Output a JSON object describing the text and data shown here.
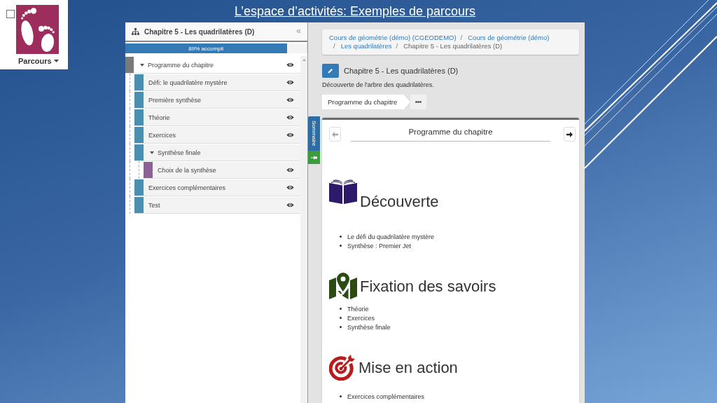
{
  "page": {
    "title": "L’espace d’activités: Exemples de parcours"
  },
  "menu": {
    "checked": false,
    "label": "Parcours"
  },
  "sidebar": {
    "title": "Chapitre 5 - Les quadrilatères (D)",
    "collapse": "«",
    "progress": {
      "level": 0.89,
      "label": "89% accompli"
    },
    "tree": [
      {
        "label": "Programme du chapitre",
        "selected": true,
        "expanded": true,
        "visible": true,
        "children": [
          {
            "label": "Défi: le quadrilatère mystère",
            "selected": false,
            "visible": true
          },
          {
            "label": "Première synthèse",
            "selected": false,
            "visible": true
          },
          {
            "label": "Théorie",
            "selected": false,
            "visible": true
          },
          {
            "label": "Exercices",
            "selected": false,
            "visible": true
          },
          {
            "label": "Synthèse finale",
            "selected": false,
            "expanded": true,
            "visible": false,
            "children": [
              {
                "label": "Choix de la synthèse",
                "selected": false,
                "visible": true
              }
            ]
          },
          {
            "label": "Exercices complémentaires",
            "selected": false,
            "visible": true
          },
          {
            "label": "Test",
            "selected": false,
            "visible": true
          }
        ]
      }
    ]
  },
  "summary_tab": {
    "label": "Sommaire"
  },
  "breadcrumb": [
    {
      "label": "Cours de géométrie (démo) (CGEODEMO)",
      "current": false
    },
    {
      "separator": "/",
      "label": "Cours de géométrie (démo)",
      "current": false
    },
    {
      "separator": "/",
      "label": "Les quadrilatères",
      "current": false
    },
    {
      "separator": "/",
      "label": "Chapitre 5 - Les quadrilatères (D)",
      "current": true
    }
  ],
  "chapter": {
    "title": "Chapitre 5 - Les quadrilatères (D)",
    "description": "Découverte de l'arbre des quadrilatères."
  },
  "steps": [
    {
      "label": "Programme du chapitre"
    }
  ],
  "content": {
    "title": "Programme du chapitre",
    "previous": {
      "disabled": true
    },
    "next": {
      "disabled": false
    },
    "sections": [
      {
        "kind": "book",
        "heading": "Découverte",
        "items": [
          "Le défi du quadrilatère mystère",
          "Synthèse : Premier Jet"
        ]
      },
      {
        "kind": "map",
        "heading": "Fixation des savoirs",
        "items": [
          "Théorie",
          "Exercices",
          "Synthèse finale"
        ]
      },
      {
        "kind": "target",
        "heading": "Mise en action",
        "items": [
          "Exercices complémentaires"
        ]
      }
    ]
  }
}
